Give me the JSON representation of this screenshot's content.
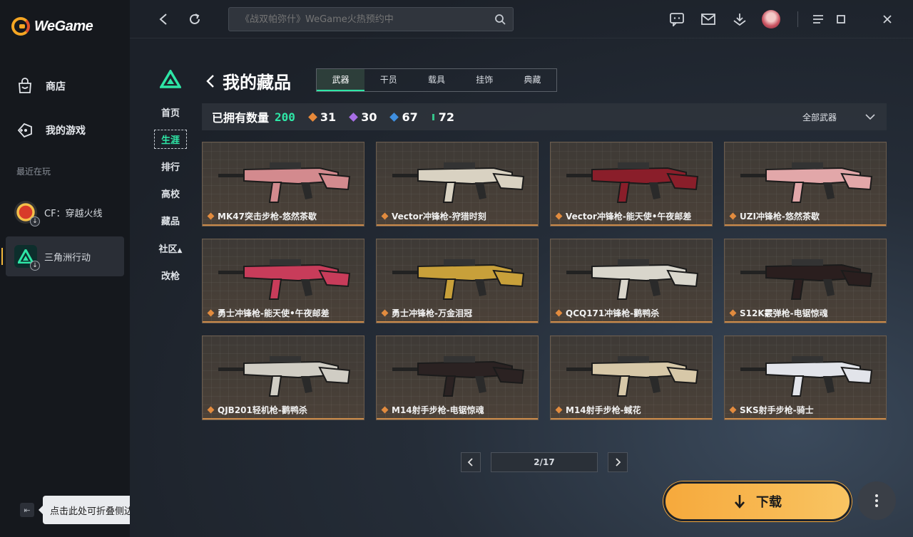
{
  "app": {
    "logo_text": "WeGame"
  },
  "sidebar": {
    "nav": [
      {
        "label": "商店",
        "icon": "store-bag-icon"
      },
      {
        "label": "我的游戏",
        "icon": "gamepad-icon"
      }
    ],
    "recent_label": "最近在玩",
    "games": [
      {
        "label": "CF：穿越火线",
        "icon": "crossfire-logo"
      },
      {
        "label": "三角洲行动",
        "icon": "delta-force-logo",
        "active": true
      }
    ],
    "collapse_tooltip": "点击此处可折叠侧边栏"
  },
  "topbar": {
    "search_placeholder": "《战双帕弥什》WeGame火热预约中",
    "icons": [
      "back-icon",
      "refresh-icon",
      "search-icon",
      "chat-icon",
      "mail-icon",
      "download-manager-icon",
      "avatar",
      "menu-icon",
      "minimize-icon",
      "close-icon"
    ]
  },
  "game_nav": {
    "items": [
      "首页",
      "生涯",
      "排行",
      "高校",
      "藏品",
      "社区",
      "改枪"
    ],
    "active": "生涯"
  },
  "collection": {
    "title": "我的藏品",
    "tabs": [
      "武器",
      "干员",
      "载具",
      "挂饰",
      "典藏"
    ],
    "active_tab": "武器",
    "owned_label": "已拥有数量",
    "owned_count": "200",
    "rarity_counts": [
      {
        "value": "31",
        "color": "#e8893a"
      },
      {
        "value": "30",
        "color": "#a76ee6"
      },
      {
        "value": "67",
        "color": "#3f8fe0"
      },
      {
        "value": "72",
        "color": "#35c48a"
      }
    ],
    "filter_label": "全部武器",
    "items": [
      {
        "name": "MK47突击步枪-悠然茶歇",
        "color": "#d38a8e"
      },
      {
        "name": "Vector冲锋枪-狩猎时刻",
        "color": "#d9d2c2"
      },
      {
        "name": "Vector冲锋枪-能天使•午夜邮差",
        "color": "#8a1e2a"
      },
      {
        "name": "UZI冲锋枪-悠然茶歇",
        "color": "#e2a7a9"
      },
      {
        "name": "勇士冲锋枪-能天使•午夜邮差",
        "color": "#c83c5a"
      },
      {
        "name": "勇士冲锋枪-万金泪冠",
        "color": "#c8a03a"
      },
      {
        "name": "QCQ171冲锋枪-鹳鸭杀",
        "color": "#d9d6cc"
      },
      {
        "name": "S12K霰弹枪-电锯惊魂",
        "color": "#2a1e1e"
      },
      {
        "name": "QJB201轻机枪-鹳鸭杀",
        "color": "#d0cdc4"
      },
      {
        "name": "M14射手步枪-电锯惊魂",
        "color": "#2b2222"
      },
      {
        "name": "M14射手步枪-蜮花",
        "color": "#d7c8a8"
      },
      {
        "name": "SKS射手步枪-骑士",
        "color": "#e2e4ea"
      }
    ]
  },
  "pager": {
    "current": "2/17"
  },
  "actions": {
    "download_label": "下载"
  }
}
